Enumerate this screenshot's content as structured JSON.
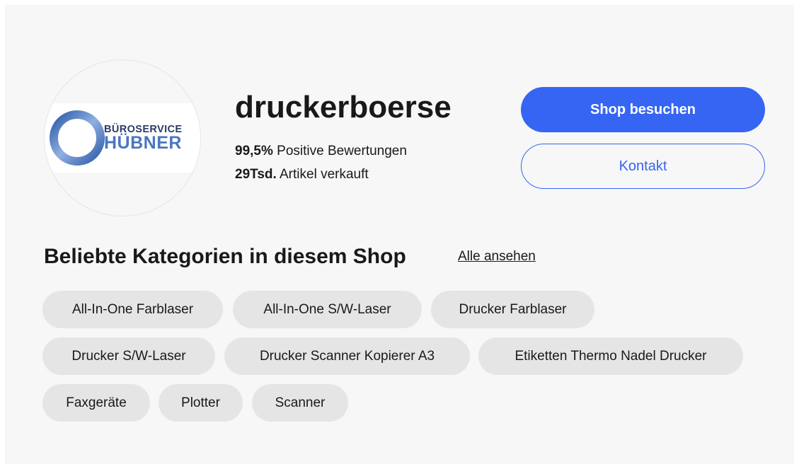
{
  "logo": {
    "line1": "BÜROSERVICE",
    "line2": "HÜBNER",
    "ring_color": "#4a76bf",
    "text_color_top": "#2c3a66",
    "text_color_main": "#4a76bf"
  },
  "seller": {
    "name": "druckerboerse",
    "feedback_value": "99,5%",
    "feedback_label": " Positive Bewertungen",
    "sold_value": "29Tsd.",
    "sold_label": " Artikel verkauft"
  },
  "actions": {
    "visit_shop": "Shop besuchen",
    "contact": "Kontakt"
  },
  "categories": {
    "title": "Beliebte Kategorien in diesem Shop",
    "see_all": "Alle ansehen",
    "items": [
      "All-In-One Farblaser",
      "All-In-One S/W-Laser",
      "Drucker Farblaser",
      "Drucker S/W-Laser",
      "Drucker Scanner Kopierer A3",
      "Etiketten Thermo Nadel Drucker",
      "Faxgeräte",
      "Plotter",
      "Scanner"
    ]
  },
  "colors": {
    "accent": "#3665f3",
    "background": "#f7f7f7",
    "chip": "#e5e5e5",
    "text": "#191919"
  }
}
